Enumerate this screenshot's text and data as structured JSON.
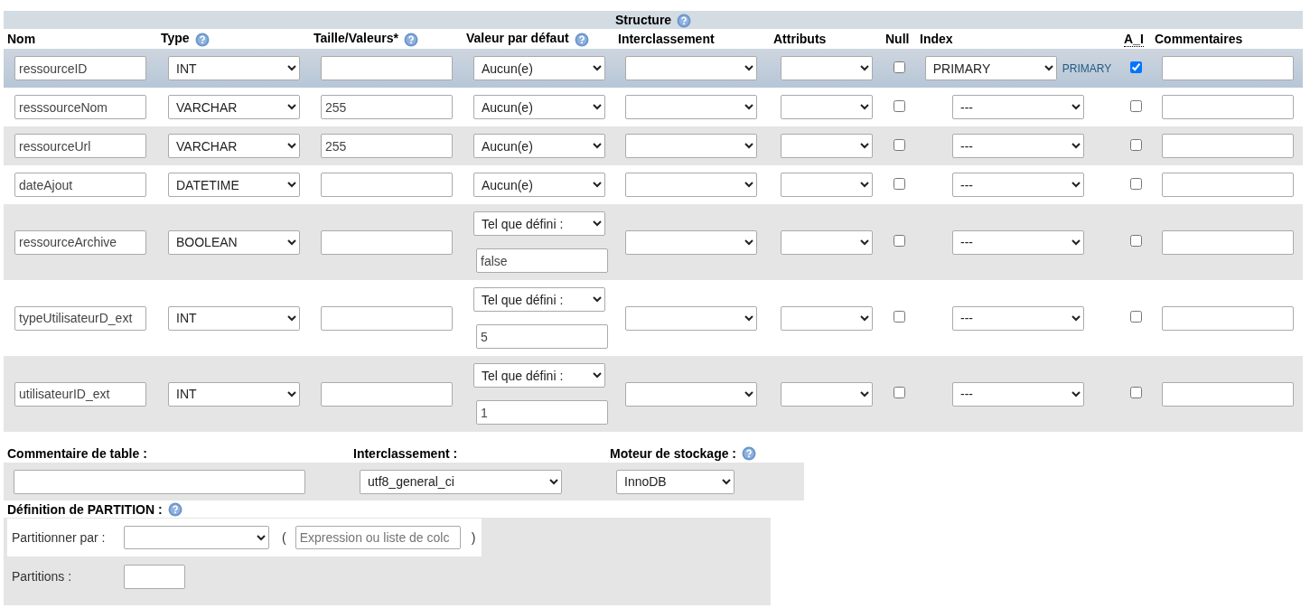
{
  "structure": {
    "title": "Structure",
    "help": true,
    "columns": [
      {
        "label": "Nom",
        "help": false,
        "abbreviation": false
      },
      {
        "label": "Type",
        "help": true,
        "abbreviation": false
      },
      {
        "label": "Taille/Valeurs*",
        "help": true,
        "abbreviation": false
      },
      {
        "label": "Valeur par défaut",
        "help": true,
        "abbreviation": false
      },
      {
        "label": "Interclassement",
        "help": false,
        "abbreviation": false
      },
      {
        "label": "Attributs",
        "help": false,
        "abbreviation": false
      },
      {
        "label": "Null",
        "help": false,
        "abbreviation": false
      },
      {
        "label": "Index",
        "help": false,
        "abbreviation": false
      },
      {
        "label": "A_I",
        "help": false,
        "abbreviation": true
      },
      {
        "label": "Commentaires",
        "help": false,
        "abbreviation": false
      }
    ],
    "rows": [
      {
        "name": "ressourceID",
        "type": "INT",
        "default": "Aucun(e)",
        "null": false,
        "index": "PRIMARY",
        "index_label": "PRIMARY",
        "ai": true,
        "highlighted": true
      },
      {
        "name": "resssourceNom",
        "type": "VARCHAR",
        "length": "255",
        "default": "Aucun(e)",
        "null": false,
        "index": "---",
        "ai": false,
        "highlighted": false
      },
      {
        "name": "ressourceUrl",
        "type": "VARCHAR",
        "length": "255",
        "default": "Aucun(e)",
        "null": false,
        "index": "---",
        "ai": false,
        "highlighted": false
      },
      {
        "name": "dateAjout",
        "type": "DATETIME",
        "default": "Aucun(e)",
        "null": false,
        "index": "---",
        "ai": false,
        "highlighted": false
      },
      {
        "name": "ressourceArchive",
        "type": "BOOLEAN",
        "default": "Tel que défini :",
        "default_value": "false",
        "null": false,
        "index": "---",
        "ai": false,
        "highlighted": false
      },
      {
        "name": "typeUtilisateurD_ext",
        "type": "INT",
        "default": "Tel que défini :",
        "default_value": "5",
        "null": false,
        "index": "---",
        "ai": false,
        "highlighted": false
      },
      {
        "name": "utilisateurID_ext",
        "type": "INT",
        "default": "Tel que défini :",
        "default_value": "1",
        "null": false,
        "index": "---",
        "ai": false,
        "highlighted": false
      }
    ]
  },
  "table_options": {
    "comment_label": "Commentaire de table :",
    "collation_label": "Interclassement :",
    "collation": "utf8_general_ci",
    "engine_label": "Moteur de stockage :",
    "engine_help": true,
    "engine": "InnoDB"
  },
  "partition": {
    "title": "Définition de PARTITION :",
    "help": true,
    "partition_by_label": "Partitionner par :",
    "open_paren": "(",
    "expression_placeholder": "Expression ou liste de colc",
    "close_paren": ")",
    "partitions_label": "Partitions :"
  }
}
